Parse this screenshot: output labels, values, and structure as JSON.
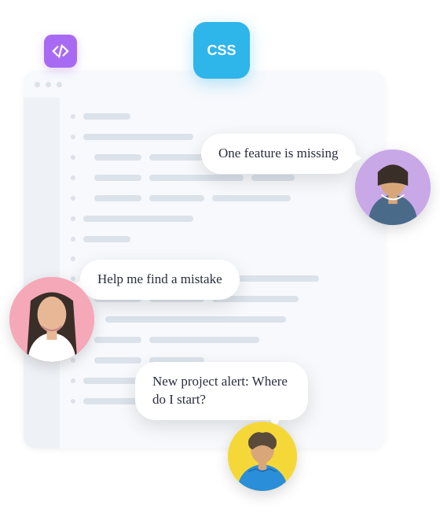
{
  "badges": {
    "css_label": "CSS"
  },
  "bubbles": {
    "b1": "One feature is missing",
    "b2": "Help me find a mistake",
    "b3": "New project alert: Where do I start?"
  },
  "avatars": {
    "a1_bg": "#c9a8e8",
    "a2_bg": "#f5a8b8",
    "a3_bg": "#f5d838"
  }
}
